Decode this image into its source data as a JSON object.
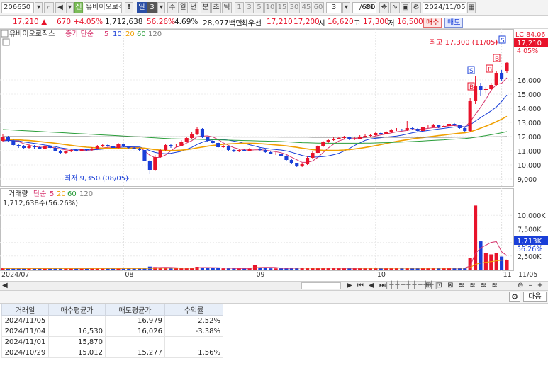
{
  "toolbar": {
    "stock_code": "206650",
    "badge": "신",
    "stock_name": "유바이오로직",
    "excl": "!",
    "period_day": "일",
    "period_num": "3",
    "periods": [
      "주",
      "월",
      "년",
      "분",
      "초",
      "틱"
    ],
    "ticks": [
      "1",
      "3",
      "5",
      "10",
      "15",
      "30",
      "45",
      "60"
    ],
    "tick_sel": "3",
    "count": "81",
    "count_total": "/600",
    "date": "2024/11/05"
  },
  "info": {
    "price": "17,210",
    "change": "670",
    "change_pct": "+4.05%",
    "volume": "1,712,638",
    "vol_ratio": "56.26%",
    "turnover": "4.69%",
    "amount": "28,977백만",
    "best_label": "최우선",
    "best_ask": "17,210",
    "best_bid": "17,200",
    "open_label": "시",
    "open": "16,620",
    "high_label": "고",
    "high": "17,300",
    "low_label": "저",
    "low": "16,500",
    "buy_btn": "매수",
    "sell_btn": "매도"
  },
  "legend": {
    "price": {
      "name": "유바이오로직스",
      "ma_label": "종가 단순",
      "periods": [
        "5",
        "10",
        "20",
        "60",
        "120"
      ]
    },
    "volume": {
      "name": "거래량",
      "ma_label": "단순",
      "periods": [
        "5",
        "20",
        "60",
        "120"
      ],
      "current": "1,712,638주(56.26%)"
    }
  },
  "annotations": {
    "lc": "LC:84.06",
    "high_text": "최고 17,300 (11/05)",
    "low_text": "최저 9,350 (08/05)",
    "last_price": "17,210",
    "last_pct": "4.05%",
    "vol_last": "1,713K",
    "vol_last_pct": "56.26%"
  },
  "colors": {
    "up": "#e8132b",
    "down": "#1a3fd8",
    "ma5": "#d6336c",
    "ma10": "#1a3fd8",
    "ma20": "#f0a000",
    "ma60": "#2a9d3a",
    "ma120": "#777777"
  },
  "chart_data": {
    "type": "candlestick",
    "price_axis": {
      "ticks": [
        "9,000",
        "10,000",
        "11,000",
        "12,000",
        "13,000",
        "14,000",
        "15,000",
        "16,000"
      ],
      "ylim": [
        8600,
        19000
      ]
    },
    "volume_axis": {
      "ticks": [
        "2,500K",
        "5,000K",
        "7,500K",
        "10,000K"
      ],
      "ylim": [
        0,
        12500
      ]
    },
    "x_labels": [
      {
        "label": "2024/07",
        "index": 0
      },
      {
        "label": "08",
        "index": 23
      },
      {
        "label": "09",
        "index": 48
      },
      {
        "label": "10",
        "index": 71
      },
      {
        "label": "11",
        "index": 95
      },
      {
        "label": "11/05",
        "index": 98
      }
    ],
    "close": [
      11950,
      11700,
      11400,
      11300,
      11200,
      11350,
      11250,
      11150,
      11300,
      11200,
      11000,
      10850,
      10950,
      11050,
      11000,
      11100,
      11050,
      11150,
      11300,
      11400,
      11300,
      11200,
      11450,
      11300,
      11200,
      11150,
      11050,
      10300,
      9650,
      10550,
      11050,
      11400,
      11300,
      11350,
      11650,
      11900,
      12150,
      12550,
      11950,
      11700,
      11550,
      11250,
      11300,
      11050,
      10950,
      11050,
      11000,
      11100,
      11150,
      11050,
      10900,
      10800,
      10800,
      10650,
      10350,
      10100,
      9900,
      10050,
      10500,
      10850,
      11300,
      11600,
      11750,
      11850,
      11900,
      11950,
      11800,
      11850,
      12000,
      12050,
      12100,
      12250,
      12200,
      12300,
      12450,
      12500,
      12450,
      12600,
      12550,
      12400,
      12650,
      12700,
      12800,
      12650,
      12750,
      12900,
      12800,
      12600,
      12400,
      14500,
      15600,
      15300,
      15350,
      15650,
      16500,
      16050,
      17210
    ],
    "open": [
      11700,
      11950,
      11700,
      11400,
      11300,
      11200,
      11350,
      11250,
      11150,
      11300,
      11200,
      11000,
      10850,
      10950,
      11050,
      11000,
      11100,
      11050,
      11150,
      11300,
      11400,
      11300,
      11200,
      11450,
      11300,
      11200,
      11150,
      11050,
      10300,
      9650,
      10550,
      11050,
      11400,
      11300,
      11350,
      11650,
      11900,
      12150,
      12550,
      11950,
      11700,
      11550,
      11250,
      11300,
      11050,
      10950,
      11050,
      11000,
      11100,
      11150,
      11050,
      10900,
      10800,
      10800,
      10650,
      10350,
      10100,
      9900,
      10050,
      10500,
      10850,
      11300,
      11600,
      11750,
      11850,
      11900,
      11950,
      11800,
      11850,
      12000,
      12050,
      12100,
      12250,
      12200,
      12300,
      12450,
      12500,
      12450,
      12600,
      12550,
      12400,
      12650,
      12700,
      12800,
      12650,
      12750,
      12900,
      12800,
      12600,
      12400,
      14500,
      15600,
      15300,
      15350,
      15650,
      16500,
      16620
    ],
    "high": [
      12150,
      12050,
      11800,
      11450,
      11400,
      11450,
      11400,
      11300,
      11400,
      11350,
      11250,
      11050,
      11000,
      11100,
      11150,
      11150,
      11150,
      11250,
      11400,
      11500,
      11450,
      11350,
      11550,
      11500,
      11350,
      11250,
      11200,
      11050,
      10350,
      10700,
      11150,
      11500,
      11450,
      11450,
      11750,
      12000,
      12300,
      12700,
      12600,
      12000,
      11750,
      11600,
      11400,
      11350,
      11100,
      11150,
      11100,
      11200,
      13700,
      11200,
      11100,
      10950,
      10900,
      10850,
      10700,
      10400,
      10150,
      10150,
      10600,
      10950,
      11400,
      11700,
      11850,
      11950,
      12000,
      12050,
      12000,
      11950,
      12100,
      12150,
      12200,
      12350,
      12300,
      12400,
      12550,
      12600,
      12550,
      13100,
      12650,
      12600,
      12750,
      12800,
      12900,
      12850,
      12850,
      13000,
      12950,
      12850,
      12650,
      14700,
      16300,
      15800,
      15500,
      15800,
      16600,
      16700,
      17300
    ],
    "low": [
      11600,
      11650,
      11350,
      11200,
      11100,
      11150,
      11150,
      11100,
      11100,
      11150,
      10950,
      10800,
      10800,
      10900,
      10950,
      10950,
      11000,
      11000,
      11100,
      11250,
      11250,
      11150,
      11150,
      11250,
      11150,
      11100,
      11000,
      10250,
      9350,
      9600,
      10500,
      11000,
      11200,
      11250,
      11300,
      11600,
      11850,
      12100,
      11900,
      11650,
      11500,
      11200,
      11200,
      11000,
      10900,
      10900,
      10950,
      10950,
      11050,
      10950,
      10850,
      10750,
      10700,
      10600,
      10300,
      10050,
      9850,
      9850,
      10000,
      10450,
      10800,
      11250,
      11550,
      11700,
      11800,
      11850,
      11750,
      11750,
      11800,
      11950,
      12000,
      12050,
      12150,
      12150,
      12250,
      12400,
      12400,
      12400,
      12500,
      12350,
      12350,
      12600,
      12650,
      12600,
      12650,
      12700,
      12750,
      12550,
      12350,
      12350,
      14300,
      14900,
      15050,
      15250,
      15550,
      15950,
      16500
    ],
    "volume": [
      250,
      230,
      220,
      230,
      200,
      190,
      210,
      200,
      210,
      220,
      260,
      230,
      210,
      220,
      200,
      210,
      220,
      230,
      240,
      230,
      210,
      220,
      250,
      230,
      210,
      220,
      240,
      380,
      560,
      480,
      380,
      320,
      280,
      270,
      300,
      330,
      360,
      520,
      420,
      330,
      280,
      260,
      240,
      230,
      220,
      210,
      240,
      250,
      900,
      420,
      260,
      240,
      230,
      240,
      270,
      300,
      320,
      330,
      320,
      300,
      290,
      280,
      270,
      260,
      250,
      240,
      250,
      260,
      270,
      260,
      250,
      280,
      270,
      260,
      280,
      290,
      300,
      340,
      300,
      280,
      290,
      280,
      300,
      290,
      280,
      300,
      320,
      310,
      340,
      2200,
      11800,
      5200,
      3000,
      2800,
      3000,
      2400,
      1713
    ],
    "ma": {
      "5": [
        11700,
        11750,
        11700,
        11650,
        11500,
        11390,
        11300,
        11250,
        11250,
        11250,
        11200,
        11120,
        11060,
        11010,
        10970,
        10990,
        11030,
        11050,
        11120,
        11200,
        11240,
        11270,
        11330,
        11330,
        11290,
        11240,
        11230,
        11000,
        10680,
        10510,
        10540,
        10700,
        10990,
        11250,
        11350,
        11540,
        11710,
        11990,
        12030,
        12050,
        11970,
        11790,
        11550,
        11370,
        11220,
        11120,
        11070,
        11040,
        11060,
        11070,
        11040,
        10990,
        10930,
        10860,
        10740,
        10540,
        10360,
        10180,
        10180,
        10280,
        10540,
        10870,
        11200,
        11460,
        11690,
        11810,
        11850,
        11870,
        11900,
        11930,
        11960,
        12040,
        12120,
        12190,
        12260,
        12340,
        12380,
        12440,
        12500,
        12500,
        12530,
        12580,
        12630,
        12640,
        12710,
        12760,
        12780,
        12740,
        12690,
        13040,
        13580,
        14080,
        14630,
        15280,
        15680,
        15770,
        16150
      ],
      "10": [
        11700,
        11720,
        11720,
        11700,
        11620,
        11570,
        11520,
        11460,
        11400,
        11350,
        11290,
        11200,
        11150,
        11100,
        11070,
        11060,
        11060,
        11060,
        11080,
        11110,
        11160,
        11200,
        11240,
        11260,
        11270,
        11270,
        11260,
        11170,
        11000,
        10880,
        10810,
        10790,
        10820,
        10890,
        10960,
        11100,
        11240,
        11440,
        11600,
        11710,
        11770,
        11820,
        11790,
        11750,
        11680,
        11620,
        11520,
        11420,
        11330,
        11230,
        11170,
        11120,
        11080,
        11050,
        10990,
        10890,
        10780,
        10670,
        10590,
        10550,
        10560,
        10590,
        10640,
        10720,
        10820,
        10980,
        11160,
        11370,
        11550,
        11730,
        11830,
        11880,
        11920,
        11960,
        12000,
        12040,
        12100,
        12180,
        12270,
        12330,
        12380,
        12430,
        12490,
        12540,
        12580,
        12630,
        12680,
        12690,
        12700,
        12820,
        13100,
        13340,
        13570,
        13820,
        14090,
        14480,
        14940
      ],
      "20": [
        11800,
        11800,
        11790,
        11770,
        11740,
        11720,
        11690,
        11650,
        11610,
        11570,
        11530,
        11480,
        11430,
        11380,
        11330,
        11290,
        11250,
        11220,
        11200,
        11180,
        11170,
        11160,
        11160,
        11170,
        11180,
        11190,
        11200,
        11180,
        11130,
        11080,
        11040,
        11020,
        11010,
        11020,
        11040,
        11080,
        11130,
        11200,
        11260,
        11320,
        11370,
        11410,
        11450,
        11480,
        11500,
        11520,
        11530,
        11530,
        11520,
        11500,
        11470,
        11440,
        11410,
        11380,
        11340,
        11290,
        11240,
        11180,
        11130,
        11080,
        11050,
        11030,
        11020,
        11020,
        11030,
        11050,
        11080,
        11120,
        11170,
        11230,
        11290,
        11360,
        11430,
        11510,
        11590,
        11660,
        11720,
        11780,
        11840,
        11890,
        11930,
        11980,
        12020,
        12070,
        12110,
        12160,
        12200,
        12240,
        12270,
        12340,
        12460,
        12600,
        12740,
        12890,
        13050,
        13230,
        13430
      ],
      "60": [
        12500,
        12480,
        12460,
        12440,
        12420,
        12400,
        12380,
        12360,
        12340,
        12320,
        12300,
        12280,
        12260,
        12240,
        12220,
        12200,
        12180,
        12160,
        12140,
        12120,
        12100,
        12080,
        12060,
        12040,
        12020,
        12000,
        11980,
        11960,
        11930,
        11910,
        11890,
        11870,
        11850,
        11840,
        11830,
        11820,
        11810,
        11810,
        11800,
        11790,
        11780,
        11770,
        11760,
        11750,
        11740,
        11730,
        11720,
        11710,
        11700,
        11690,
        11680,
        11670,
        11660,
        11650,
        11630,
        11610,
        11590,
        11570,
        11560,
        11550,
        11540,
        11540,
        11530,
        11530,
        11530,
        11530,
        11530,
        11530,
        11530,
        11540,
        11540,
        11550,
        11560,
        11570,
        11580,
        11600,
        11610,
        11630,
        11650,
        11670,
        11690,
        11710,
        11730,
        11750,
        11770,
        11800,
        11820,
        11840,
        11860,
        11900,
        11950,
        12010,
        12070,
        12130,
        12200,
        12270,
        12350
      ],
      "120": [
        12000,
        12000,
        12000,
        12000,
        12000,
        12000,
        12000,
        12000,
        12000,
        12000,
        12000,
        12000,
        12000,
        12000,
        12000,
        12000,
        12000,
        11990,
        11990,
        11990,
        11990,
        11990,
        11990,
        11990,
        11990,
        11990,
        11990,
        11980,
        11980,
        11980,
        11980,
        11980,
        11980,
        11980,
        11980,
        11980,
        11980,
        11980,
        11980,
        11980,
        11980,
        11980,
        11980,
        11980,
        11970,
        11970,
        11970,
        11970,
        11970,
        11970,
        11970,
        11970,
        11970,
        11960,
        11960,
        11960,
        11960,
        11960,
        11960,
        11950,
        11950,
        11950,
        11950,
        11950,
        11950,
        11950,
        11950,
        11950,
        11950,
        11950,
        11950,
        11950,
        11950,
        11950,
        11950,
        11950,
        11950,
        11950,
        11950,
        11950,
        11950,
        11950,
        11950,
        11950,
        11950,
        11950,
        11960,
        11960,
        11960,
        11960,
        11970,
        11970,
        11980,
        11980,
        11990,
        11990,
        12000
      ]
    }
  },
  "table": {
    "headers": [
      "거래일",
      "매수평균가",
      "매도평균가",
      "수익률"
    ],
    "rows": [
      {
        "date": "2024/11/05",
        "buy": "",
        "sell": "16,979",
        "ret": "2.52%",
        "ret_color": "red"
      },
      {
        "date": "2024/11/04",
        "buy": "16,530",
        "sell": "16,026",
        "ret": "-3.38%",
        "ret_color": "blue"
      },
      {
        "date": "2024/11/01",
        "buy": "15,870",
        "sell": "",
        "ret": "",
        "ret_color": ""
      },
      {
        "date": "2024/10/29",
        "buy": "15,012",
        "sell": "15,277",
        "ret": "1.56%",
        "ret_color": "red"
      }
    ],
    "next_btn": "다음"
  }
}
